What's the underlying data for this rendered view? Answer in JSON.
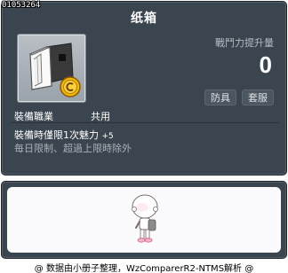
{
  "item": {
    "id": "01053264",
    "name": "纸箱",
    "icon": "cardboard-box-icon",
    "coin_icon": "gold-coin-icon"
  },
  "stats": {
    "label": "戰鬥力提升量",
    "value": "0"
  },
  "tags": {
    "category": "防具",
    "type": "套服"
  },
  "job": {
    "label": "裝備職業",
    "value": "共用"
  },
  "effect": {
    "line": "裝備時僅限1次魅力",
    "bonus": "+5",
    "limit": "毎日限制、超過上限時除外"
  },
  "preview": {
    "avatar": "character-avatar-icon"
  },
  "footer": {
    "credit": "@ 数据由小册子整理，WzComparerR2-NTMS解析 @"
  },
  "colors": {
    "panel_bg": "#3b4550",
    "panel_border": "#1e242b",
    "text_primary": "#ffffff",
    "text_secondary": "#aab0b6"
  }
}
